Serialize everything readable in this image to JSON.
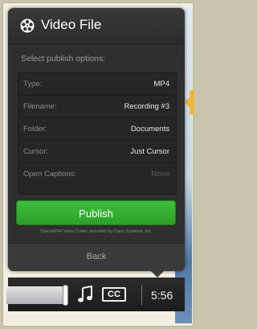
{
  "panel": {
    "title": "Video File",
    "subtitle": "Select publish options:",
    "options": [
      {
        "label": "Type:",
        "value": "MP4",
        "dim": false
      },
      {
        "label": "Filename:",
        "value": "Recording #3",
        "dim": false
      },
      {
        "label": "Folder:",
        "value": "Documents",
        "dim": false
      },
      {
        "label": "Cursor:",
        "value": "Just Cursor",
        "dim": false
      },
      {
        "label": "Open Captions:",
        "value": "None",
        "dim": true
      }
    ],
    "publish_label": "Publish",
    "codec_note": "OpenH264 Video Codec provided by Cisco Systems, Inc.",
    "back_label": "Back"
  },
  "control_bar": {
    "cc_label": "CC",
    "time": "5:56"
  },
  "icons": {
    "title": "film-reel-icon",
    "audio": "music-note-icon",
    "captions": "closed-captions-icon",
    "callout": "callout-pointer-icon"
  },
  "colors": {
    "panel": "#2f2f2f",
    "publish": "#34ab31",
    "callout": "#f0b53b"
  }
}
